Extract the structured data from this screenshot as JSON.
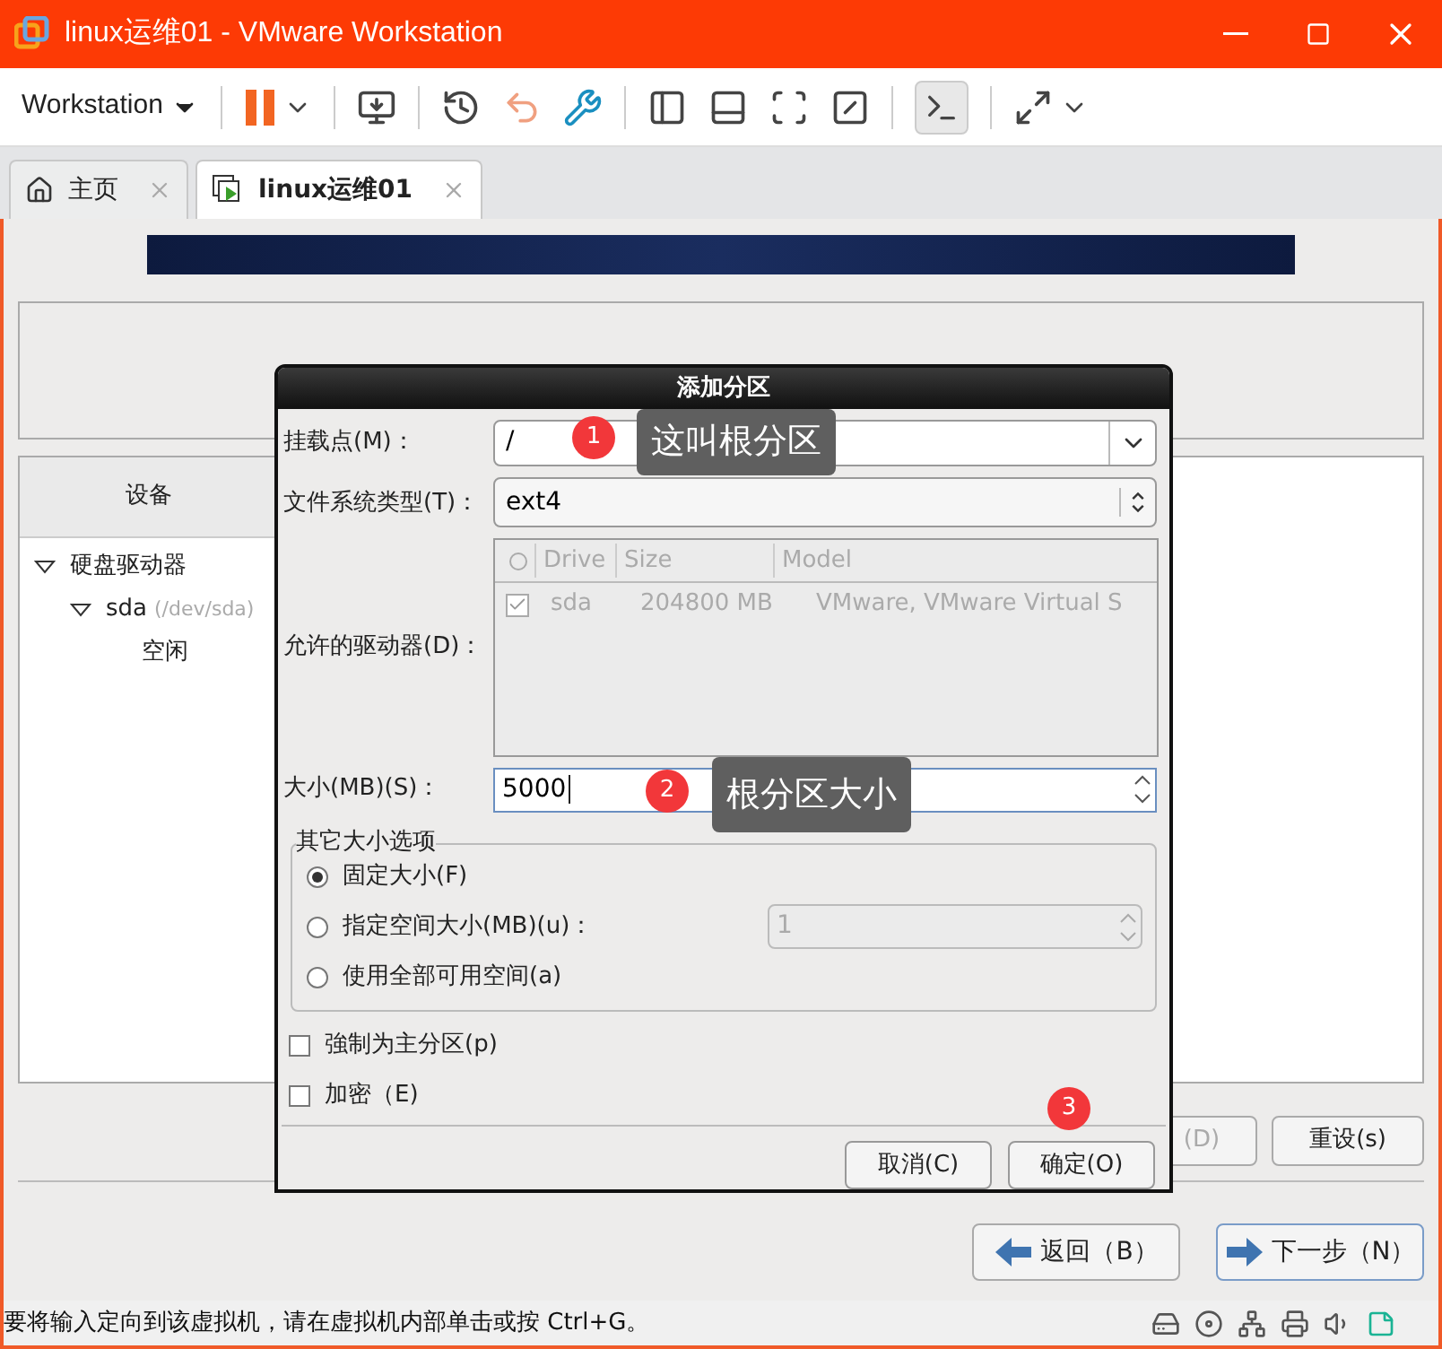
{
  "window": {
    "title": "linux运维01 - VMware Workstation"
  },
  "toolbar": {
    "menu": "Workstation"
  },
  "tabs": [
    {
      "label": "主页",
      "selected": false
    },
    {
      "label": "linux运维01",
      "selected": true
    }
  ],
  "installer": {
    "device_header": "设备",
    "tree": [
      {
        "label": "硬盘驱动器",
        "expanded": true,
        "children": [
          {
            "label": "sda",
            "hint": "(/dev/sda)",
            "expanded": true,
            "children": [
              {
                "label": "空闲"
              }
            ]
          }
        ]
      }
    ],
    "buttons": [
      {
        "label": "(D)",
        "disabled": true
      },
      {
        "label": "重设(s)",
        "disabled": false
      }
    ],
    "nav": [
      {
        "label": "返回（B）",
        "kind": "back"
      },
      {
        "label": "下一步（N）",
        "kind": "next"
      }
    ]
  },
  "dialog": {
    "title": "添加分区",
    "mount_label": "挂载点(M)：",
    "mount_value": "/",
    "fs_label": "文件系统类型(T)：",
    "fs_value": "ext4",
    "drives_label": "允许的驱动器(D)：",
    "drive_columns": [
      "Drive",
      "Size",
      "Model"
    ],
    "drives": [
      {
        "checked": true,
        "drive": "sda",
        "size": "204800 MB",
        "model": "VMware, VMware Virtual S"
      }
    ],
    "size_label": "大小(MB)(S)：",
    "size_value": "5000",
    "size_options": {
      "legend": "其它大小选项",
      "options": [
        {
          "label": "固定大小(F)",
          "selected": true
        },
        {
          "label": "指定空间大小(MB)(u)：",
          "selected": false,
          "value": "1"
        },
        {
          "label": "使用全部可用空间(a)",
          "selected": false
        }
      ]
    },
    "checkboxes": [
      {
        "label": "強制为主分区(p)",
        "checked": false
      },
      {
        "label": "加密（E)",
        "checked": false
      }
    ],
    "buttons": [
      "取消(C)",
      "确定(O)"
    ]
  },
  "annotations": [
    {
      "number": "1",
      "text": "这叫根分区"
    },
    {
      "number": "2",
      "text": "根分区大小"
    },
    {
      "number": "3"
    }
  ],
  "status_bar": {
    "text": "要将输入定向到该虚拟机，请在虚拟机内部单击或按 Ctrl+G。"
  }
}
